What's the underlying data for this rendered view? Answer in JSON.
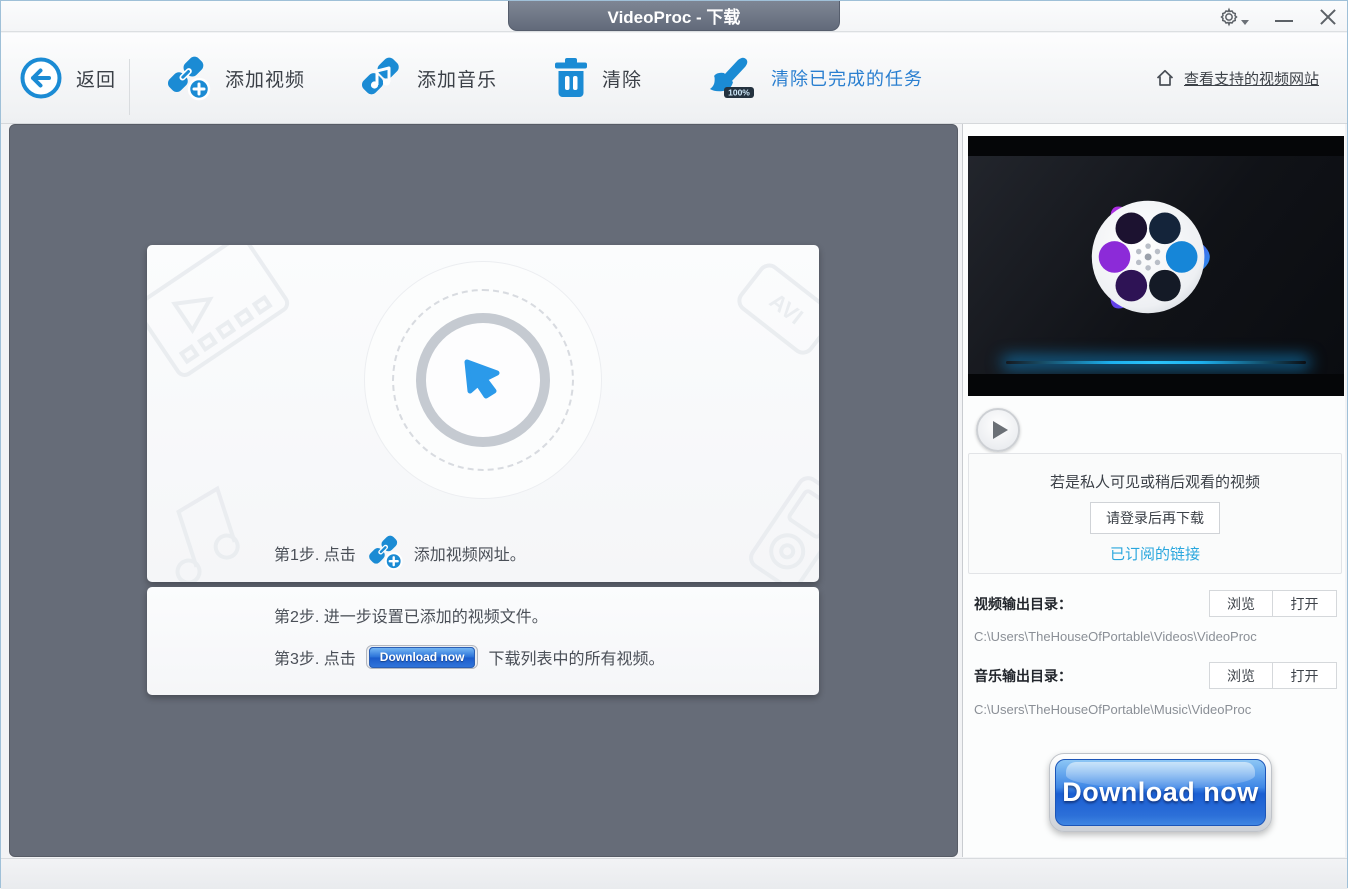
{
  "titlebar": {
    "title": "VideoProc - 下载"
  },
  "toolbar": {
    "back": "返回",
    "add_video": "添加视频",
    "add_music": "添加音乐",
    "clear": "清除",
    "clear_finished": "清除已完成的任务",
    "badge_100": "100%",
    "supported_sites": "查看支持的视频网站"
  },
  "steps": {
    "step1_prefix": "第1步. 点击",
    "step1_suffix": "添加视频网址。",
    "step2": "第2步. 进一步设置已添加的视频文件。",
    "step3_prefix": "第3步. 点击",
    "step3_button": "Download now",
    "step3_suffix": "下载列表中的所有视频。"
  },
  "panel": {
    "private_notice": "若是私人可见或稍后观看的视频",
    "login_button": "请登录后再下载",
    "subscribed_link": "已订阅的链接",
    "video_dir_label": "视频输出目录：",
    "music_dir_label": "音乐输出目录：",
    "browse_button": "浏览",
    "open_button": "打开",
    "video_dir_path": "C:\\Users\\TheHouseOfPortable\\Videos\\VideoProc",
    "music_dir_path": "C:\\Users\\TheHouseOfPortable\\Music\\VideoProc",
    "download_button": "Download now"
  },
  "decor": {
    "avi_label": "AVI"
  },
  "colors": {
    "accent_blue": "#1b8bd4",
    "link_blue": "#2aa7de",
    "dark_bg": "#666c78",
    "title_tab": "#6a7180"
  }
}
